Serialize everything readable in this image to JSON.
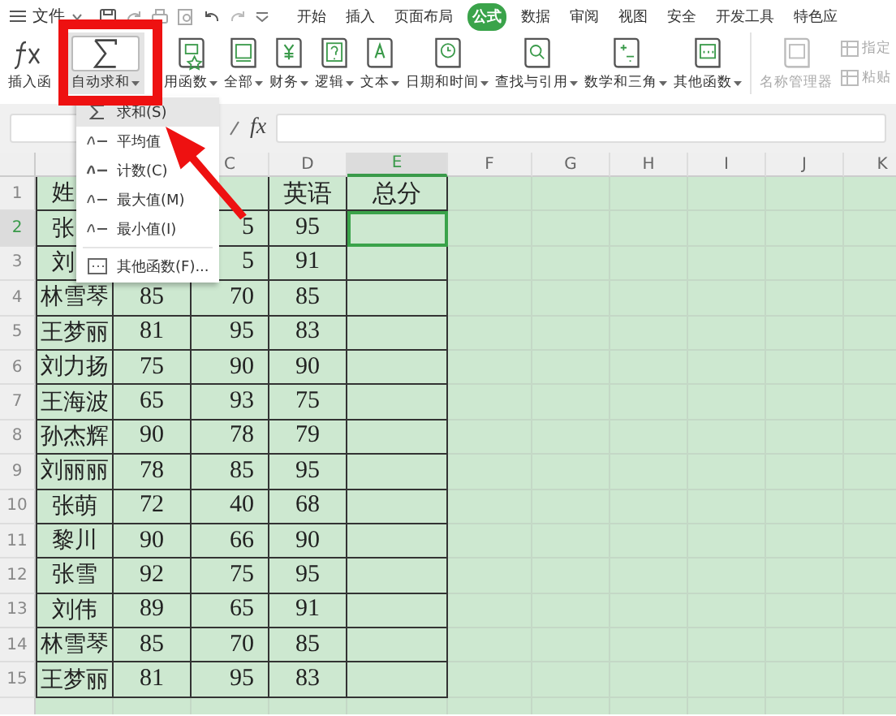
{
  "menu_bar": {
    "file_menu": "文件",
    "tabs": [
      {
        "label": "开始",
        "selected": false
      },
      {
        "label": "插入",
        "selected": false
      },
      {
        "label": "页面布局",
        "selected": false
      },
      {
        "label": "公式",
        "selected": true
      },
      {
        "label": "数据",
        "selected": false
      },
      {
        "label": "审阅",
        "selected": false
      },
      {
        "label": "视图",
        "selected": false
      },
      {
        "label": "安全",
        "selected": false
      },
      {
        "label": "开发工具",
        "selected": false
      },
      {
        "label": "特色应",
        "selected": false
      }
    ]
  },
  "ribbon": {
    "buttons": [
      {
        "kind": "fx",
        "label": "插入函",
        "dropdown": false,
        "highlighted": false
      },
      {
        "kind": "sum",
        "label": "自动求和",
        "dropdown": true,
        "highlighted": true
      },
      {
        "kind": "star",
        "label": "用函数",
        "dropdown": true,
        "highlighted": false
      },
      {
        "kind": "fx-book",
        "label": "全部",
        "dropdown": true,
        "highlighted": false
      },
      {
        "kind": "yen",
        "label": "财务",
        "dropdown": true,
        "highlighted": false
      },
      {
        "kind": "question",
        "label": "逻辑",
        "dropdown": true,
        "highlighted": false
      },
      {
        "kind": "letter",
        "label": "文本",
        "dropdown": true,
        "highlighted": false
      },
      {
        "kind": "clock",
        "label": "日期和时间",
        "dropdown": true,
        "highlighted": false
      },
      {
        "kind": "search",
        "label": "查找与引用",
        "dropdown": true,
        "highlighted": false
      },
      {
        "kind": "math",
        "label": "数学和三角",
        "dropdown": true,
        "highlighted": false
      },
      {
        "kind": "dots",
        "label": "其他函数",
        "dropdown": true,
        "highlighted": false
      },
      {
        "kind": "names",
        "label": "名称管理器",
        "dropdown": false,
        "highlighted": false,
        "disabled": true
      }
    ],
    "small_buttons": [
      {
        "label": "指定",
        "disabled": true
      },
      {
        "label": "粘贴",
        "disabled": true
      }
    ]
  },
  "formula_bar": {
    "fx": "fx"
  },
  "dropdown_menu": {
    "items": [
      {
        "kind": "sum",
        "label": "求和(S)",
        "selected": true
      },
      {
        "kind": "avg",
        "label": "平均值",
        "selected": false
      },
      {
        "kind": "cnt",
        "label": "计数(C)",
        "selected": false
      },
      {
        "kind": "max",
        "label": "最大值(M)",
        "selected": false
      },
      {
        "kind": "min",
        "label": "最小值(I)",
        "selected": false
      },
      {
        "kind": "more",
        "label": "其他函数(F)...",
        "selected": false
      }
    ]
  },
  "sheet": {
    "columns": [
      {
        "selected": false
      },
      {},
      {
        "label": "C",
        "selected": false
      },
      {
        "label": "D",
        "selected": false
      },
      {
        "label": "E",
        "selected": true
      },
      {
        "label": "F",
        "selected": false
      },
      {
        "label": "G",
        "selected": false
      },
      {
        "label": "H",
        "selected": false
      },
      {
        "label": "I",
        "selected": false
      },
      {
        "label": "J",
        "selected": false
      },
      {
        "label": "K",
        "selected": false
      }
    ],
    "rows": [
      {
        "number": "1",
        "selected": false,
        "cells": [
          "姓",
          null,
          null,
          "英语",
          "总分"
        ]
      },
      {
        "number": "2",
        "selected": true,
        "cells": [
          "张",
          null,
          "5",
          "95",
          null
        ]
      },
      {
        "number": "3",
        "selected": false,
        "cells": [
          "刘",
          null,
          "5",
          "91",
          null
        ]
      },
      {
        "number": "4",
        "selected": false,
        "cells": [
          "林雪琴",
          "85",
          "70",
          "85",
          null
        ]
      },
      {
        "number": "5",
        "selected": false,
        "cells": [
          "王梦丽",
          "81",
          "95",
          "83",
          null
        ]
      },
      {
        "number": "6",
        "selected": false,
        "cells": [
          "刘力扬",
          "75",
          "90",
          "90",
          null
        ]
      },
      {
        "number": "7",
        "selected": false,
        "cells": [
          "王海波",
          "65",
          "93",
          "75",
          null
        ]
      },
      {
        "number": "8",
        "selected": false,
        "cells": [
          "孙杰辉",
          "90",
          "78",
          "79",
          null
        ]
      },
      {
        "number": "9",
        "selected": false,
        "cells": [
          "刘丽丽",
          "78",
          "85",
          "95",
          null
        ]
      },
      {
        "number": "10",
        "selected": false,
        "cells": [
          "张萌",
          "72",
          "40",
          "68",
          null
        ]
      },
      {
        "number": "11",
        "selected": false,
        "cells": [
          "黎川",
          "90",
          "66",
          "90",
          null
        ]
      },
      {
        "number": "12",
        "selected": false,
        "cells": [
          "张雪",
          "92",
          "75",
          "95",
          null
        ]
      },
      {
        "number": "13",
        "selected": false,
        "cells": [
          "刘伟",
          "89",
          "65",
          "91",
          null
        ]
      },
      {
        "number": "14",
        "selected": false,
        "cells": [
          "林雪琴",
          "85",
          "70",
          "85",
          null
        ]
      },
      {
        "number": "15",
        "selected": false,
        "cells": [
          "王梦丽",
          "81",
          "95",
          "83",
          null
        ]
      }
    ]
  },
  "annotation": {
    "kind": "arrow-and-box"
  }
}
